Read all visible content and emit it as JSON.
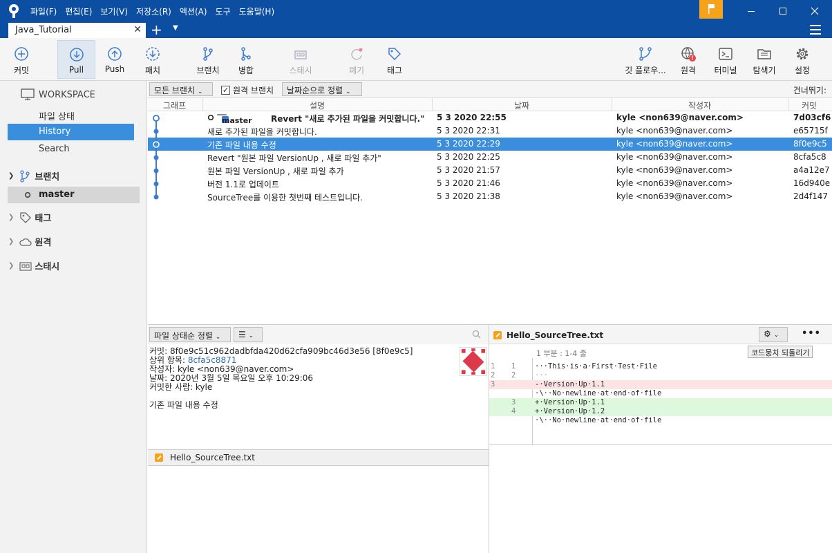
{
  "titlebar": {
    "menu": [
      "파일(F)",
      "편집(E)",
      "보기(V)",
      "저장소(R)",
      "액션(A)",
      "도구",
      "도움말(H)"
    ]
  },
  "tab": {
    "label": "Java_Tutorial",
    "close": "✕"
  },
  "toolbar": {
    "commit": "커밋",
    "pull": "Pull",
    "push": "Push",
    "fetch": "패치",
    "branch": "브랜치",
    "merge": "병합",
    "stash": "스태시",
    "discard": "폐기",
    "tag": "태그",
    "gitflow": "깃 플로우...",
    "remote": "원격",
    "terminal": "터미널",
    "explorer": "탐색기",
    "settings": "설정"
  },
  "sidebar": {
    "workspace": "WORKSPACE",
    "file_status": "파일 상태",
    "history": "History",
    "search": "Search",
    "branches": "브랜치",
    "master": "master",
    "tags": "태그",
    "remotes": "원격",
    "stashes": "스태시"
  },
  "filter": {
    "branches": "모든 브랜치",
    "remote_branches": "원격 브랜치",
    "sort": "날짜순으로 정렬",
    "jump": "건너뛰기:"
  },
  "columns": {
    "graph": "그래프",
    "desc": "설명",
    "date": "날짜",
    "author": "작성자",
    "commit": "커밋"
  },
  "commits": [
    {
      "desc": "Revert \"새로 추가된 파일을 커밋합니다.\"",
      "branch": "master",
      "date": "5 3 2020 22:55",
      "author": "kyle <non639@naver.com>",
      "hash": "7d03cf6"
    },
    {
      "desc": "새로 추가된 파일을 커밋합니다.",
      "date": "5 3 2020 22:31",
      "author": "kyle <non639@naver.com>",
      "hash": "e65715f"
    },
    {
      "desc": "기존 파일 내용 수정",
      "date": "5 3 2020 22:29",
      "author": "kyle <non639@naver.com>",
      "hash": "8f0e9c5"
    },
    {
      "desc": "Revert \"원본 파일 VersionUp , 새로 파일 추가\"",
      "date": "5 3 2020 22:25",
      "author": "kyle <non639@naver.com>",
      "hash": "8cfa5c8"
    },
    {
      "desc": "원본 파일 VersionUp , 새로 파일 추가",
      "date": "5 3 2020 21:57",
      "author": "kyle <non639@naver.com>",
      "hash": "a4a12e7"
    },
    {
      "desc": "버전 1.1로 업데이트",
      "date": "5 3 2020 21:46",
      "author": "kyle <non639@naver.com>",
      "hash": "16d940e"
    },
    {
      "desc": "SourceTree를 이용한 첫번째 테스트입니다.",
      "date": "5 3 2020 21:38",
      "author": "kyle <non639@naver.com>",
      "hash": "2d4f147"
    }
  ],
  "lower_left": {
    "sort": "파일 상태순 정렬",
    "commit_line": "커밋: 8f0e9c51c962dadbfda420d62cfa909bc46d3e56 [8f0e9c5]",
    "parent_label": "상위 항목: ",
    "parent_hash": "8cfa5c8871",
    "author": "작성자: kyle <non639@naver.com>",
    "date": "날짜: 2020년 3월 5일 목요일 오후 10:29:06",
    "committer": "커밋한 사람: kyle",
    "message": "기존 파일 내용 수정",
    "file": "Hello_SourceTree.txt"
  },
  "lower_right": {
    "file": "Hello_SourceTree.txt",
    "hunk": "1 부분 : 1-4 줄",
    "revert_hunk": "코드뭉치 되돌리기",
    "more": "•••",
    "lines": [
      {
        "o": "1",
        "n": "1",
        "t": "···This·is·a·First·Test·File",
        "k": ""
      },
      {
        "o": "2",
        "n": "2",
        "t": "···",
        "k": ""
      },
      {
        "o": "3",
        "n": "",
        "t": "-·Version·Up·1.1",
        "k": "del"
      },
      {
        "o": "",
        "n": "",
        "t": "·\\··No·newline·at·end·of·file",
        "k": ""
      },
      {
        "o": "",
        "n": "3",
        "t": "+·Version·Up·1.1",
        "k": "add"
      },
      {
        "o": "",
        "n": "4",
        "t": "+·Version·Up·1.2",
        "k": "add"
      },
      {
        "o": "",
        "n": "",
        "t": "·\\··No·newline·at·end·of·file",
        "k": ""
      }
    ]
  }
}
